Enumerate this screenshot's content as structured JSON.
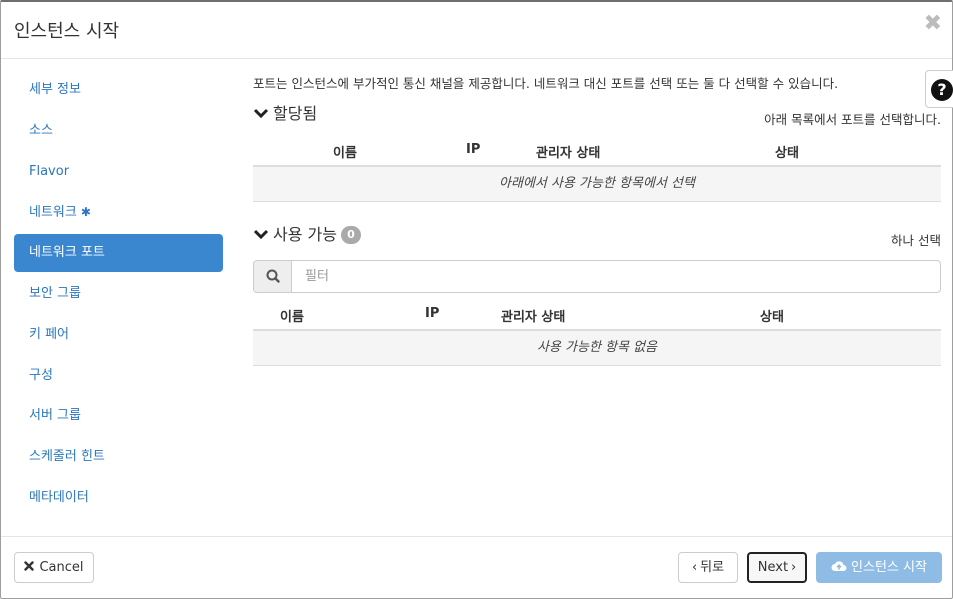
{
  "dialog": {
    "title": "인스턴스 시작",
    "close_glyph": "✖"
  },
  "sidebar": {
    "items": [
      {
        "label": "세부 정보"
      },
      {
        "label": "소스"
      },
      {
        "label": "Flavor"
      },
      {
        "label": "네트워크",
        "required_mark": "✱"
      },
      {
        "label": "네트워크 포트",
        "active": true
      },
      {
        "label": "보안 그룹"
      },
      {
        "label": "키 페어"
      },
      {
        "label": "구성"
      },
      {
        "label": "서버 그룹"
      },
      {
        "label": "스케줄러 힌트"
      },
      {
        "label": "메타데이터"
      }
    ]
  },
  "main": {
    "intro": "포트는 인스턴스에 부가적인 통신 채널을 제공합니다. 네트워크 대신 포트를 선택 또는 둘 다 선택할 수 있습니다.",
    "help_icon": "?",
    "allocated": {
      "title": "할당됨",
      "note": "아래 목록에서 포트를 선택합니다.",
      "columns": [
        "이름",
        "IP",
        "관리자 상태",
        "상태"
      ],
      "empty_text": "아래에서 사용 가능한 항목에서 선택"
    },
    "available": {
      "title": "사용 가능",
      "count": "0",
      "note": "하나 선택",
      "filter_placeholder": "필터",
      "columns": [
        "이름",
        "IP",
        "관리자 상태",
        "상태"
      ],
      "empty_text": "사용 가능한 항목 없음"
    }
  },
  "footer": {
    "cancel_label": "Cancel",
    "back_label": "뒤로",
    "next_label": "Next",
    "launch_label": "인스턴스 시작"
  },
  "colors": {
    "link": "#2a77bd",
    "active_nav": "#3a87cf",
    "launch_button": "#8fbce5",
    "badge": "#aaaaaa"
  }
}
